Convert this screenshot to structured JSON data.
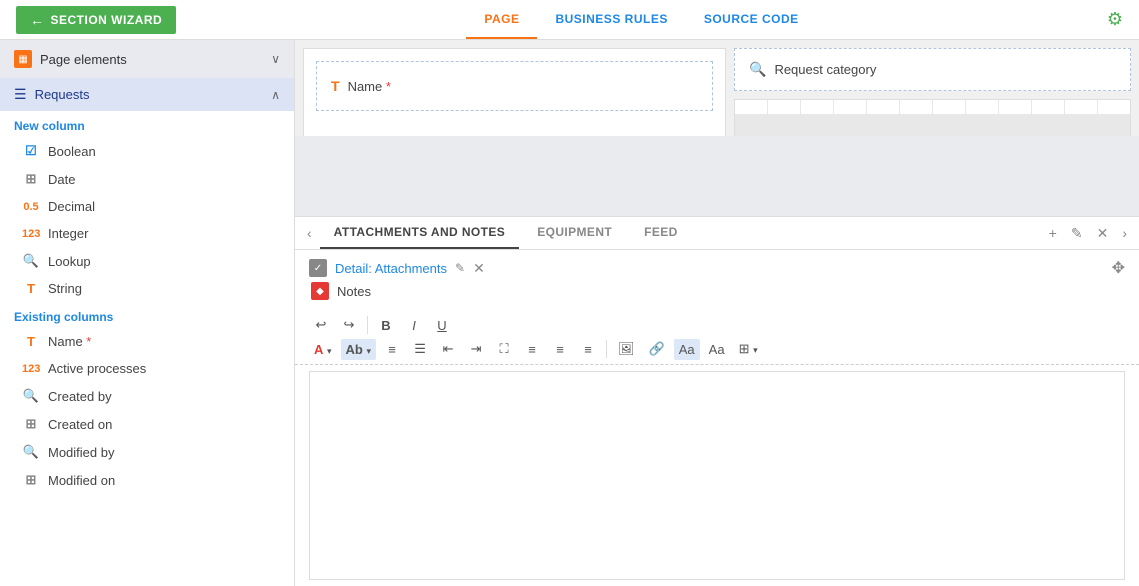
{
  "topNav": {
    "wizardBtn": "SECTION WIZARD",
    "tabs": [
      {
        "id": "page",
        "label": "PAGE",
        "active": true
      },
      {
        "id": "business-rules",
        "label": "BUSINESS RULES",
        "active": false
      },
      {
        "id": "source-code",
        "label": "SOURCE CODE",
        "active": false
      }
    ]
  },
  "sidebar": {
    "pageElements": "Page elements",
    "requests": "Requests",
    "newColumn": "New column",
    "newColumnItems": [
      {
        "id": "boolean",
        "label": "Boolean",
        "iconType": "bool"
      },
      {
        "id": "date",
        "label": "Date",
        "iconType": "date"
      },
      {
        "id": "decimal",
        "label": "Decimal",
        "iconType": "decimal"
      },
      {
        "id": "integer",
        "label": "Integer",
        "iconType": "int"
      },
      {
        "id": "lookup",
        "label": "Lookup",
        "iconType": "lookup"
      },
      {
        "id": "string",
        "label": "String",
        "iconType": "string"
      }
    ],
    "existingColumns": "Existing columns",
    "existingColumnItems": [
      {
        "id": "name",
        "label": "Name",
        "required": true,
        "iconType": "name"
      },
      {
        "id": "active-processes",
        "label": "Active processes",
        "iconType": "active"
      },
      {
        "id": "created-by",
        "label": "Created by",
        "iconType": "createdby"
      },
      {
        "id": "created-on",
        "label": "Created on",
        "iconType": "createdon"
      },
      {
        "id": "modified-by",
        "label": "Modified by",
        "iconType": "modifiedby"
      },
      {
        "id": "modified-on",
        "label": "Modified on",
        "iconType": "modifiedon"
      }
    ]
  },
  "canvas": {
    "nameField": "Name",
    "required": "*",
    "requestCategory": "Request category"
  },
  "bottomPanel": {
    "tabs": [
      {
        "id": "attachments-notes",
        "label": "ATTACHMENTS AND NOTES",
        "active": true
      },
      {
        "id": "equipment",
        "label": "EQUIPMENT",
        "active": false
      },
      {
        "id": "feed",
        "label": "FEED",
        "active": false
      }
    ],
    "detailTitle": "Detail: Attachments",
    "notes": "Notes"
  },
  "rteToolbar": {
    "undoLabel": "↩",
    "redoLabel": "↪",
    "bold": "B",
    "italic": "I",
    "underline": "U",
    "fontA": "A",
    "fontAb": "Ab",
    "listOrdered": "≡",
    "listUnordered": "☰",
    "decreaseIndent": "⇤",
    "increaseIndent": "⇥",
    "expand": "⛶",
    "alignLeft": "≡",
    "alignCenter": "≡",
    "alignRight": "≡",
    "image": "🖼",
    "link": "🔗",
    "paragraph": "Aa",
    "font": "Aa",
    "table": "⊞"
  }
}
